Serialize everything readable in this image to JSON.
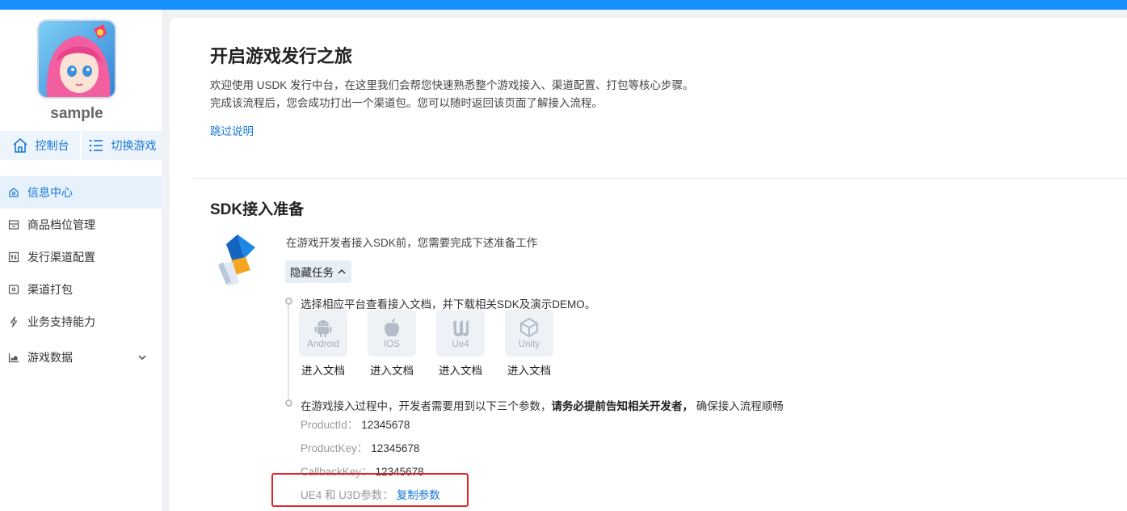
{
  "app": {
    "name": "sample"
  },
  "sidebar": {
    "quick": [
      {
        "label": "控制台",
        "icon": "home-icon"
      },
      {
        "label": "切换游戏",
        "icon": "list-icon"
      }
    ],
    "items": [
      {
        "label": "信息中心",
        "icon": "info-center-icon",
        "active": true
      },
      {
        "label": "商品档位管理",
        "icon": "goods-icon"
      },
      {
        "label": "发行渠道配置",
        "icon": "channel-config-icon"
      },
      {
        "label": "渠道打包",
        "icon": "package-icon"
      },
      {
        "label": "业务支持能力",
        "icon": "lightning-icon"
      },
      {
        "label": "游戏数据",
        "icon": "chart-icon",
        "expandable": true
      }
    ]
  },
  "main": {
    "title": "开启游戏发行之旅",
    "intro": "欢迎使用 USDK 发行中台，在这里我们会帮您快速熟悉整个游戏接入、渠道配置、打包等核心步骤。完成该流程后，您会成功打出一个渠道包。您可以随时返回该页面了解接入流程。",
    "skip_link": "跳过说明",
    "section_title": "SDK接入准备",
    "prep_text": "在游戏开发者接入SDK前，您需要完成下述准备工作",
    "hide_button": "隐藏任务",
    "step1": "选择相应平台查看接入文档，并下载相关SDK及演示DEMO。",
    "platforms": [
      {
        "name": "Android",
        "link": "进入文档",
        "icon": "android-icon"
      },
      {
        "name": "IOS",
        "link": "进入文档",
        "icon": "apple-icon"
      },
      {
        "name": "Ue4",
        "link": "进入文档",
        "icon": "unreal-icon"
      },
      {
        "name": "Unity",
        "link": "进入文档",
        "icon": "unity-icon"
      }
    ],
    "step2": {
      "before": "在游戏接入过程中，开发者需要用到以下三个参数，",
      "bold": "请务必提前告知相关开发者，",
      "after": " 确保接入流程顺畅"
    },
    "params": [
      {
        "label": "ProductId：",
        "value": "12345678"
      },
      {
        "label": "ProductKey：",
        "value": "12345678"
      },
      {
        "label": "CallbackKey：",
        "value": "12345678"
      }
    ],
    "copy_param": {
      "label": "UE4 和 U3D参数：",
      "action": "复制参数"
    }
  },
  "colors": {
    "accent": "#1677d9",
    "topbar": "#1890ff",
    "highlight": "#e02424"
  }
}
